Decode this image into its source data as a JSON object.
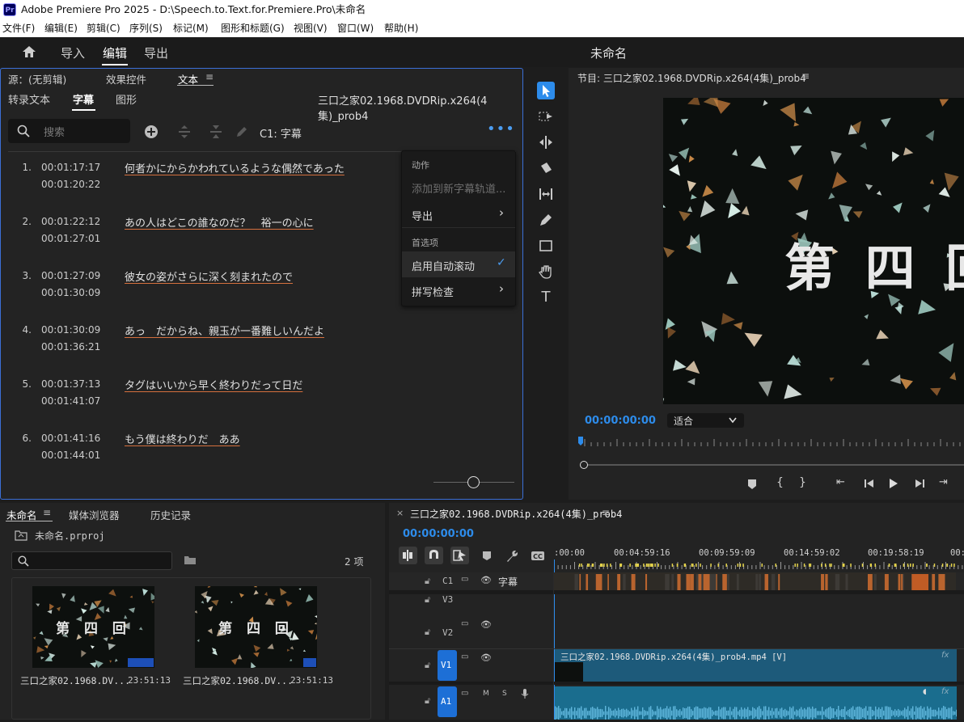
{
  "app": {
    "title": "Adobe Premiere Pro 2025 - D:\\Speech.to.Text.for.Premiere.Pro\\未命名",
    "logo": "Pr"
  },
  "menu": [
    "文件(F)",
    "编辑(E)",
    "剪辑(C)",
    "序列(S)",
    "标记(M)",
    "图形和标题(G)",
    "视图(V)",
    "窗口(W)",
    "帮助(H)"
  ],
  "workspace": {
    "tabs": [
      "导入",
      "编辑",
      "导出"
    ],
    "active": "编辑",
    "project_title": "未命名"
  },
  "source_panel": {
    "tabs": [
      "源：(无剪辑)",
      "效果控件",
      "文本"
    ],
    "subtabs": [
      "转录文本",
      "字幕",
      "图形"
    ],
    "active_subtab": "字幕",
    "sequence_name": "三口之家02.1968.DVDRip.x264(4集)_prob4",
    "search_placeholder": "搜索",
    "track_label": "C1: 字幕",
    "captions": [
      {
        "num": "1.",
        "in": "00:01:17:17",
        "out": "00:01:20:22",
        "text": "何者かにからかわれているような偶然であった"
      },
      {
        "num": "2.",
        "in": "00:01:22:12",
        "out": "00:01:27:01",
        "text": "あの人はどこの誰なのだ？　裕一の心に"
      },
      {
        "num": "3.",
        "in": "00:01:27:09",
        "out": "00:01:30:09",
        "text": "彼女の姿がさらに深く刻まれたので"
      },
      {
        "num": "4.",
        "in": "00:01:30:09",
        "out": "00:01:36:21",
        "text": "あっ　だからね、親玉が一番難しいんだよ"
      },
      {
        "num": "5.",
        "in": "00:01:37:13",
        "out": "00:01:41:07",
        "text": "タグはいいから早く終わりだって日だ"
      },
      {
        "num": "6.",
        "in": "00:01:41:16",
        "out": "00:01:44:01",
        "text": "もう僕は終わりだ　ああ"
      }
    ]
  },
  "context_menu": {
    "header_actions": "动作",
    "add_track": "添加到新字幕轨道...",
    "export": "导出",
    "header_prefs": "首选项",
    "auto_scroll": "启用自动滚动",
    "auto_scroll_checked": true,
    "spellcheck": "拼写检查"
  },
  "program_monitor": {
    "title": "节目: 三口之家02.1968.DVDRip.x264(4集)_prob4",
    "timecode": "00:00:00:00",
    "fit": "适合",
    "frame_text": "第 四 回"
  },
  "project_panel": {
    "tabs": [
      "未命名",
      "媒体浏览器",
      "历史记录"
    ],
    "file": "未命名.prproj",
    "count": "2 项",
    "items": [
      {
        "name": "三口之家02.1968.DV...",
        "duration": "23:51:13",
        "frame_text": "第 四 回"
      },
      {
        "name": "三口之家02.1968.DV...",
        "duration": "23:51:13",
        "frame_text": "第 四 回"
      }
    ]
  },
  "timeline": {
    "title": "三口之家02.1968.DVDRip.x264(4集)_prob4",
    "timecode": "00:00:00:00",
    "ruler": [
      ":00:00",
      "00:04:59:16",
      "00:09:59:09",
      "00:14:59:02",
      "00:19:58:19",
      "00:"
    ],
    "tracks": {
      "c1": "C1",
      "c1_name": "字幕",
      "v3": "V3",
      "v2": "V2",
      "v1": "V1",
      "a1": "A1",
      "m": "M",
      "s": "S"
    },
    "clip_v1": "三口之家02.1968.DVDRip.x264(4集)_prob4.mp4 [V]",
    "fx": "fx"
  },
  "colors": {
    "accent": "#2d8ceb",
    "timecode": "#2d8ceb",
    "underline": "#d5703e",
    "clip_video": "#1d5a7a",
    "clip_audio": "#1a6d8e",
    "track_select": "#1d6fd6"
  }
}
